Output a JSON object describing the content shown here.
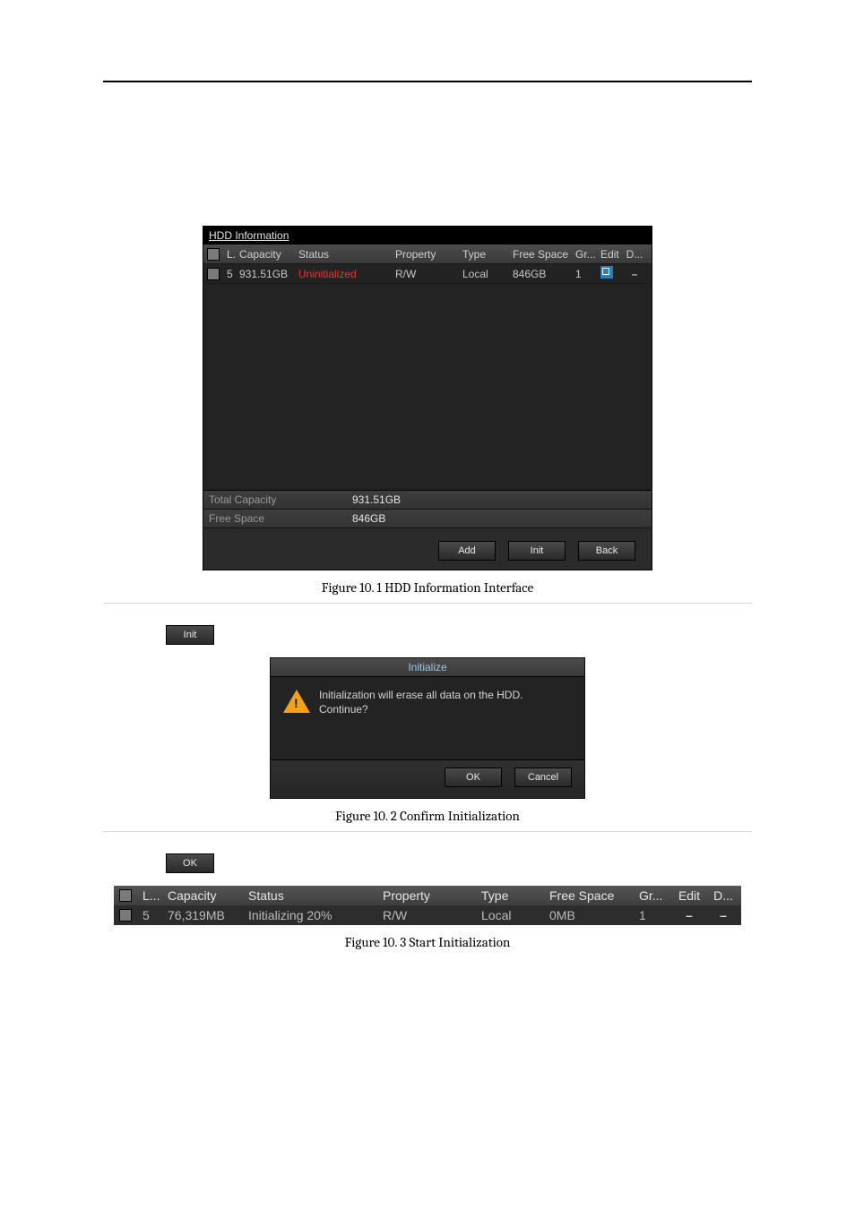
{
  "fig1": {
    "title": "HDD Information",
    "columns": {
      "l": "L...",
      "capacity": "Capacity",
      "status": "Status",
      "property": "Property",
      "type": "Type",
      "free": "Free Space",
      "gr": "Gr...",
      "edit": "Edit",
      "d": "D..."
    },
    "row": {
      "l": "5",
      "capacity": "931.51GB",
      "status": "Uninitialized",
      "property": "R/W",
      "type": "Local",
      "free": "846GB",
      "gr": "1"
    },
    "summary": {
      "total_label": "Total Capacity",
      "total_val": "931.51GB",
      "free_label": "Free Space",
      "free_val": "846GB"
    },
    "buttons": {
      "add": "Add",
      "init": "Init",
      "back": "Back"
    },
    "caption": "Figure 10. 1 HDD Information Interface"
  },
  "fig2": {
    "step_button": "Init",
    "dialog_title": "Initialize",
    "message_line1": "Initialization will erase all data on the HDD.",
    "message_line2": "Continue?",
    "ok": "OK",
    "cancel": "Cancel",
    "caption": "Figure 10. 2 Confirm Initialization"
  },
  "fig3": {
    "step_button": "OK",
    "columns": {
      "l": "L...",
      "capacity": "Capacity",
      "status": "Status",
      "property": "Property",
      "type": "Type",
      "free": "Free Space",
      "gr": "Gr...",
      "edit": "Edit",
      "d": "D..."
    },
    "row": {
      "l": "5",
      "capacity": "76,319MB",
      "status": "Initializing 20%",
      "property": "R/W",
      "type": "Local",
      "free": "0MB",
      "gr": "1"
    },
    "caption": "Figure 10. 3 Start Initialization"
  }
}
